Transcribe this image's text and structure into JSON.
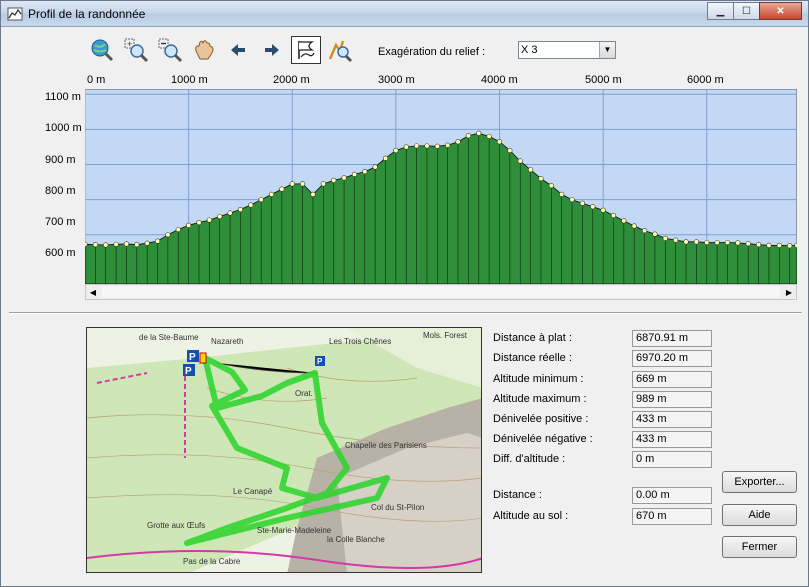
{
  "window": {
    "title": "Profil de la randonnée"
  },
  "toolbar": {
    "tools": [
      "zoom-globe-icon",
      "zoom-in-icon",
      "zoom-out-icon",
      "pan-hand-icon",
      "arrow-left-icon",
      "arrow-right-icon",
      "profile-flag-icon",
      "walker-search-icon"
    ],
    "relief_label": "Exagération du relief :",
    "relief_value": "X 3"
  },
  "chart_data": {
    "type": "area",
    "x_tick_labels": [
      "0 m",
      "1000 m",
      "2000 m",
      "3000 m",
      "4000 m",
      "5000 m",
      "6000 m"
    ],
    "y_tick_labels": [
      "1100 m",
      "1000 m",
      "900 m",
      "800 m",
      "700 m",
      "600 m"
    ],
    "xlim": [
      0,
      6870.91
    ],
    "ylim": [
      560,
      1115
    ],
    "grid": true,
    "distance": [
      0,
      100,
      200,
      300,
      400,
      500,
      600,
      700,
      800,
      900,
      1000,
      1100,
      1200,
      1300,
      1400,
      1500,
      1600,
      1700,
      1800,
      1900,
      2000,
      2100,
      2200,
      2300,
      2400,
      2500,
      2600,
      2700,
      2800,
      2900,
      3000,
      3100,
      3200,
      3300,
      3400,
      3500,
      3600,
      3700,
      3800,
      3900,
      4000,
      4100,
      4200,
      4300,
      4400,
      4500,
      4600,
      4700,
      4800,
      4900,
      5000,
      5100,
      5200,
      5300,
      5400,
      5500,
      5600,
      5700,
      5800,
      5900,
      6000,
      6100,
      6200,
      6300,
      6400,
      6500,
      6600,
      6700,
      6800,
      6870
    ],
    "altitude": [
      673,
      672,
      671,
      673,
      674,
      672,
      676,
      682,
      700,
      715,
      727,
      735,
      742,
      752,
      762,
      772,
      785,
      800,
      815,
      830,
      845,
      845,
      815,
      845,
      855,
      862,
      872,
      880,
      893,
      918,
      940,
      950,
      953,
      953,
      952,
      955,
      965,
      982,
      989,
      980,
      965,
      940,
      910,
      885,
      860,
      840,
      815,
      800,
      790,
      780,
      770,
      755,
      740,
      725,
      712,
      702,
      690,
      685,
      680,
      680,
      678,
      678,
      678,
      677,
      675,
      672,
      670,
      670,
      669,
      670
    ],
    "fill_color": "#2f8e3a",
    "marker_color": "#ffffb0",
    "bg_color": "#c2d8f4"
  },
  "map": {
    "labels": [
      "de la Ste-Baume",
      "Nazareth",
      "Les Trois Chênes",
      "Orat.",
      "Chapelle des Parisiens",
      "Le Canapé",
      "Col du St-Pilon",
      "Grotte aux Œufs",
      "Ste-Marie-Madeleine",
      "la Colle Blanche",
      "Pas de la Cabre",
      "Mols. Forest"
    ]
  },
  "stats": [
    {
      "label": "Distance à plat :",
      "value": "6870.91 m"
    },
    {
      "label": "Distance réelle :",
      "value": "6970.20 m"
    },
    {
      "label": "Altitude minimum :",
      "value": "669 m"
    },
    {
      "label": "Altitude maximum :",
      "value": "989 m"
    },
    {
      "label": "Dénivelée positive :",
      "value": "433 m"
    },
    {
      "label": "Dénivelée négative :",
      "value": "433 m"
    },
    {
      "label": "Diff. d'altitude :",
      "value": "0 m"
    }
  ],
  "cursor": [
    {
      "label": "Distance :",
      "value": "0.00 m"
    },
    {
      "label": "Altitude au sol :",
      "value": "670 m"
    }
  ],
  "buttons": {
    "export": "Exporter...",
    "help": "Aide",
    "close": "Fermer"
  }
}
